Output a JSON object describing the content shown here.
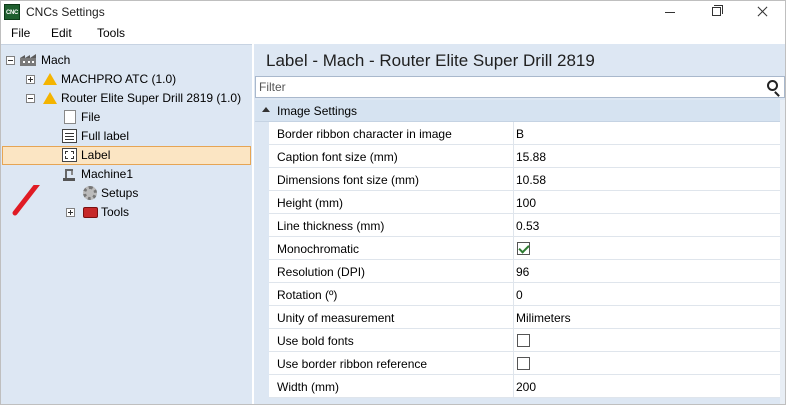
{
  "window": {
    "title": "CNCs Settings",
    "app_icon_text": "CNC"
  },
  "menu": {
    "file": "File",
    "edit": "Edit",
    "tools": "Tools"
  },
  "tree": {
    "root": "Mach",
    "machpro": "MACHPRO ATC (1.0)",
    "router": "Router Elite Super Drill 2819 (1.0)",
    "file": "File",
    "full_label": "Full label",
    "label": "Label",
    "machine1": "Machine1",
    "setups": "Setups",
    "tools": "Tools"
  },
  "main": {
    "page_title": "Label - Mach - Router Elite Super Drill 2819",
    "filter_placeholder": "Filter",
    "group_title": "Image Settings"
  },
  "properties": [
    {
      "name": "Border ribbon character in image",
      "value": "B",
      "type": "text"
    },
    {
      "name": "Caption font size (mm)",
      "value": "15.88",
      "type": "text"
    },
    {
      "name": "Dimensions font size (mm)",
      "value": "10.58",
      "type": "text"
    },
    {
      "name": "Height (mm)",
      "value": "100",
      "type": "text"
    },
    {
      "name": "Line thickness (mm)",
      "value": "0.53",
      "type": "text"
    },
    {
      "name": "Monochromatic",
      "value": true,
      "type": "checkbox"
    },
    {
      "name": "Resolution (DPI)",
      "value": "96",
      "type": "text"
    },
    {
      "name": "Rotation (º)",
      "value": "0",
      "type": "text"
    },
    {
      "name": "Unity of measurement",
      "value": "Milimeters",
      "type": "text"
    },
    {
      "name": "Use bold fonts",
      "value": false,
      "type": "checkbox"
    },
    {
      "name": "Use border ribbon reference",
      "value": false,
      "type": "checkbox"
    },
    {
      "name": "Width (mm)",
      "value": "200",
      "type": "text"
    }
  ],
  "colors": {
    "panel_bg": "#dde7f3",
    "selection_bg": "#fbe5c3",
    "selection_border": "#e6a554",
    "warning_icon": "#f4b400",
    "annotation_arrow": "#e01b24"
  },
  "icons": [
    "cnc-app-icon",
    "factory-icon",
    "warning-icon",
    "file-icon",
    "full-label-icon",
    "label-icon",
    "machine-icon",
    "gear-icon",
    "toolbox-icon",
    "search-icon"
  ]
}
